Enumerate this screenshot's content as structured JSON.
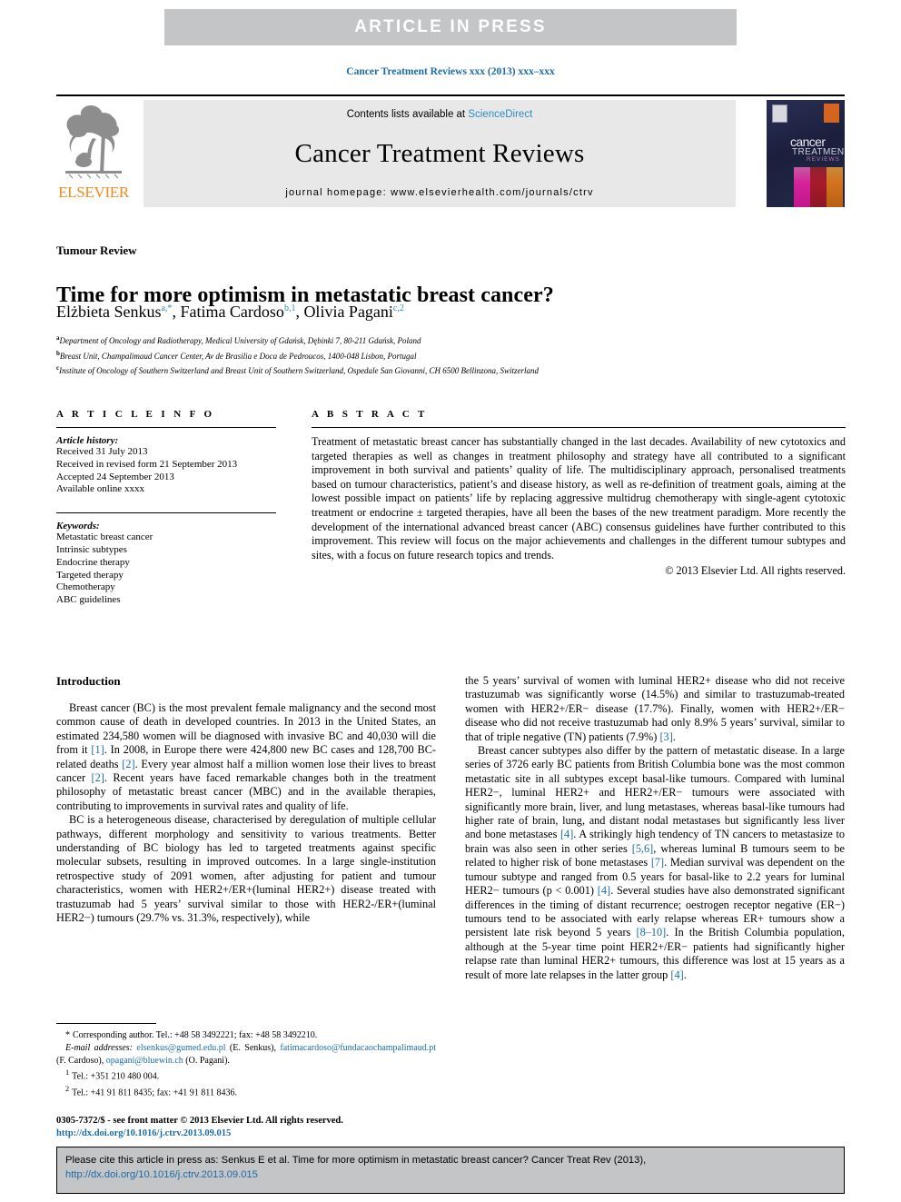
{
  "banner": {
    "text": "ARTICLE  IN  PRESS"
  },
  "running_head": "Cancer Treatment Reviews xxx (2013) xxx–xxx",
  "masthead": {
    "contents_prefix": "Contents lists available at ",
    "sciencedirect": "ScienceDirect",
    "journal_title": "Cancer Treatment Reviews",
    "homepage": "journal homepage: www.elsevierhealth.com/journals/ctrv",
    "publisher": "ELSEVIER",
    "cover": {
      "word1": "cancer",
      "word2": "TREATMENT",
      "word3": "REVIEWS"
    }
  },
  "article": {
    "section_label": "Tumour Review",
    "title": "Time for more optimism in metastatic breast cancer?",
    "authors": [
      {
        "name": "Elżbieta Senkus",
        "marks": "a,*"
      },
      {
        "name": "Fatima Cardoso",
        "marks": "b,1"
      },
      {
        "name": "Olivia Pagani",
        "marks": "c,2"
      }
    ],
    "affiliations": [
      {
        "mark": "a",
        "text": "Department of Oncology and Radiotherapy, Medical University of Gdańsk, Dębinki 7, 80-211 Gdańsk, Poland"
      },
      {
        "mark": "b",
        "text": "Breast Unit, Champalimaud Cancer Center, Av de Brasilia e Doca de Pedroucos, 1400-048 Lisbon, Portugal"
      },
      {
        "mark": "c",
        "text": "Institute of Oncology of Southern Switzerland and Breast Unit of Southern Switzerland, Ospedale San Giovanni, CH 6500 Bellinzona, Switzerland"
      }
    ]
  },
  "article_info": {
    "heading": "A R T I C L E    I N F O",
    "history_label": "Article history:",
    "history": [
      "Received 31 July 2013",
      "Received in revised form 21 September 2013",
      "Accepted 24 September 2013",
      "Available online xxxx"
    ],
    "keywords_label": "Keywords:",
    "keywords": [
      "Metastatic breast cancer",
      "Intrinsic subtypes",
      "Endocrine therapy",
      "Targeted therapy",
      "Chemotherapy",
      "ABC guidelines"
    ]
  },
  "abstract": {
    "heading": "A B S T R A C T",
    "text": "Treatment of metastatic breast cancer has substantially changed in the last decades. Availability of new cytotoxics and targeted therapies as well as changes in treatment philosophy and strategy have all contributed to a significant improvement in both survival and patients’ quality of life. The multidisciplinary approach, personalised treatments based on tumour characteristics, patient’s and disease history, as well as re-definition of treatment goals, aiming at the lowest possible impact on patients’ life by replacing aggressive multidrug chemotherapy with single-agent cytotoxic treatment or endocrine ± targeted therapies, have all been the bases of the new treatment paradigm. More recently the development of the international advanced breast cancer (ABC) consensus guidelines have further contributed to this improvement. This review will focus on the major achievements and challenges in the different tumour subtypes and sites, with a focus on future research topics and trends.",
    "copyright": "© 2013 Elsevier Ltd. All rights reserved."
  },
  "body": {
    "heading": "Introduction",
    "left_paragraphs": [
      "Breast cancer (BC) is the most prevalent female malignancy and the second most common cause of death in developed countries. In 2013 in the United States, an estimated 234,580 women will be diagnosed with invasive BC and 40,030 will die from it [1]. In 2008, in Europe there were 424,800 new BC cases and 128,700 BC-related deaths [2]. Every year almost half a million women lose their lives to breast cancer [2]. Recent years have faced remarkable changes both in the treatment philosophy of metastatic breast cancer (MBC) and in the available therapies, contributing to improvements in survival rates and quality of life.",
      "BC is a heterogeneous disease, characterised by deregulation of multiple cellular pathways, different morphology and sensitivity to various treatments. Better understanding of BC biology has led to targeted treatments against specific molecular subsets, resulting in improved outcomes. In a large single-institution retrospective study of 2091 women, after adjusting for patient and tumour characteristics, women with HER2+/ER+(luminal HER2+) disease treated with trastuzumab had 5 years’ survival similar to those with HER2-/ER+(luminal HER2−) tumours (29.7% vs. 31.3%, respectively), while"
    ],
    "right_paragraphs": [
      "the 5 years’ survival of women with luminal HER2+ disease who did not receive trastuzumab was significantly worse (14.5%) and similar to trastuzumab-treated women with HER2+/ER− disease (17.7%). Finally, women with HER2+/ER− disease who did not receive trastuzumab had only 8.9% 5 years’ survival, similar to that of triple negative (TN) patients (7.9%) [3].",
      "Breast cancer subtypes also differ by the pattern of metastatic disease. In a large series of 3726 early BC patients from British Columbia bone was the most common metastatic site in all subtypes except basal-like tumours. Compared with luminal HER2−, luminal HER2+ and HER2+/ER− tumours were associated with significantly more brain, liver, and lung metastases, whereas basal-like tumours had higher rate of brain, lung, and distant nodal metastases but significantly less liver and bone metastases [4]. A strikingly high tendency of TN cancers to metastasize to brain was also seen in other series [5,6], whereas luminal B tumours seem to be related to higher risk of bone metastases [7]. Median survival was dependent on the tumour subtype and ranged from 0.5 years for basal-like to 2.2 years for luminal HER2− tumours (p < 0.001) [4]. Several studies have also demonstrated significant differences in the timing of distant recurrence; oestrogen receptor negative (ER−) tumours tend to be associated with early relapse whereas ER+ tumours show a persistent late risk beyond 5 years [8–10]. In the British Columbia population, although at the 5-year time point HER2+/ER− patients had significantly higher relapse rate than luminal HER2+ tumours, this difference was lost at 15 years as a result of more late relapses in the latter group [4]."
    ]
  },
  "footnotes": {
    "corresponding": "Corresponding author. Tel.: +48 58 3492221; fax: +48 58 3492210.",
    "corresponding_mark": "*",
    "email_label": "E-mail addresses:",
    "emails": [
      {
        "address": "elsenkus@gumed.edu.pl",
        "owner": "(E. Senkus)"
      },
      {
        "address": "fatimacardoso@fundacaochampalimaud.pt",
        "owner": "(F. Cardoso)"
      },
      {
        "address": "opagani@bluewin.ch",
        "owner": "(O. Pagani)"
      }
    ],
    "notes": [
      {
        "mark": "1",
        "text": "Tel.: +351 210 480 004."
      },
      {
        "mark": "2",
        "text": "Tel.: +41 91 811 8435; fax: +41 91 811 8436."
      }
    ]
  },
  "issn_line": {
    "text": "0305-7372/$ - see front matter © 2013 Elsevier Ltd. All rights reserved.",
    "doi": "http://dx.doi.org/10.1016/j.ctrv.2013.09.015"
  },
  "cite_box": {
    "text": "Please cite this article in press as: Senkus E et al. Time for more optimism in metastatic breast cancer? Cancer Treat Rev (2013), ",
    "doi": "http://dx.doi.org/10.1016/j.ctrv.2013.09.015"
  },
  "colors": {
    "banner_bg": "#c3c5c7",
    "link": "#1a6ca8",
    "sciencedirect": "#2b8cc4",
    "elsevier_orange": "#f08a1c",
    "masthead_bg": "#e8e8e8"
  }
}
